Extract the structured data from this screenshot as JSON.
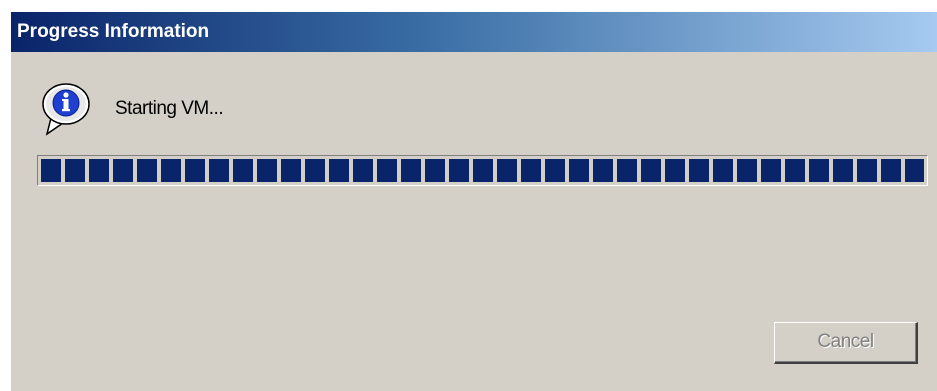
{
  "window": {
    "title": "Progress Information"
  },
  "message": {
    "icon": "info-icon",
    "text": "Starting VM..."
  },
  "progress": {
    "percent": 100
  },
  "buttons": {
    "cancel_label": "Cancel",
    "cancel_enabled": false
  },
  "colors": {
    "title_gradient_start": "#0a246a",
    "title_gradient_end": "#a6caf0",
    "dialog_background": "#d4d0c8",
    "progress_block": "#0a246a",
    "disabled_text": "#808080"
  }
}
